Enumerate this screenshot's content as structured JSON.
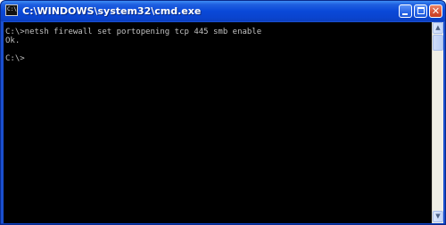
{
  "window": {
    "title": "C:\\WINDOWS\\system32\\cmd.exe",
    "icon": "cmd-app-icon",
    "icon_text": "C:\\"
  },
  "console": {
    "lines": [
      "C:\\>netsh firewall set portopening tcp 445 smb enable",
      "Ok.",
      "",
      "C:\\>"
    ],
    "text_color": "#c0c0c0",
    "background_color": "#000000"
  },
  "controls": {
    "minimize": "minimize-icon",
    "maximize": "maximize-icon",
    "close": "close-icon",
    "close_glyph": "✕"
  },
  "scrollbar": {
    "up_glyph": "▲",
    "down_glyph": "▼",
    "position": "top"
  },
  "colors": {
    "titlebar": "#0a49d8",
    "close_button": "#d9543a"
  }
}
